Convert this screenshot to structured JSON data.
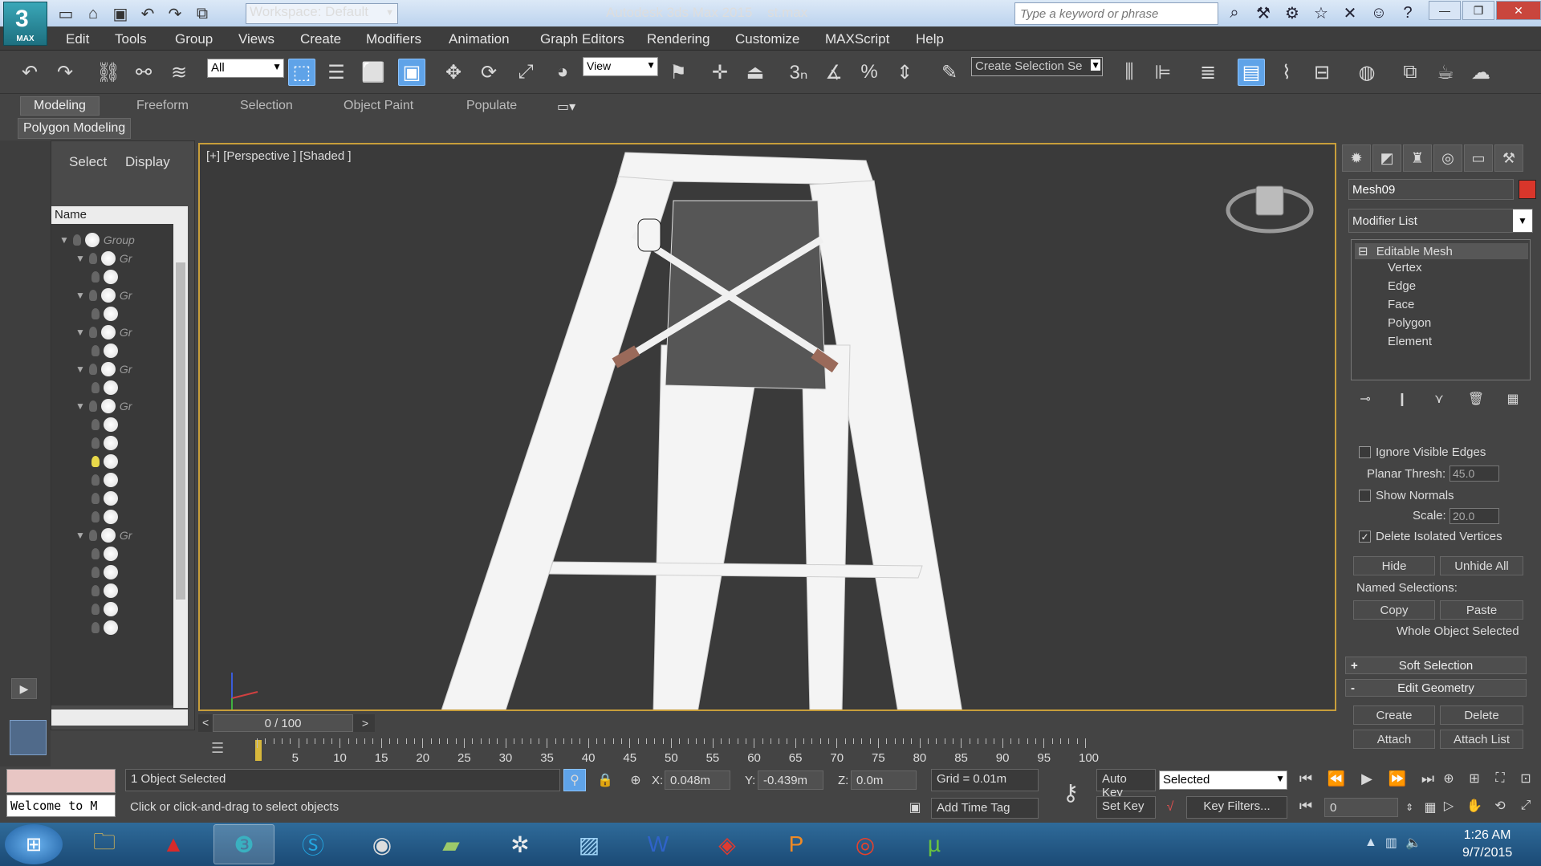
{
  "app": {
    "logo_label": "MAX",
    "title": "Autodesk 3ds Max  2015",
    "filename": "st.max",
    "workspace": "Workspace: Default",
    "search_placeholder": "Type a keyword or phrase"
  },
  "menu": [
    "Edit",
    "Tools",
    "Group",
    "Views",
    "Create",
    "Modifiers",
    "Animation",
    "Graph Editors",
    "Rendering",
    "Customize",
    "MAXScript",
    "Help"
  ],
  "toolbar": {
    "selection_filter": "All",
    "ref_coord": "View",
    "named_selection": "Create Selection Se"
  },
  "ribbon": {
    "tabs": [
      "Modeling",
      "Freeform",
      "Selection",
      "Object Paint",
      "Populate"
    ],
    "active_tab": "Modeling",
    "panel": "Polygon Modeling"
  },
  "scene_explorer": {
    "tabs": [
      "Select",
      "Display"
    ],
    "column": "Name",
    "top_group": "Group",
    "child_label": "Gr"
  },
  "viewport": {
    "label": "[+] [Perspective ] [Shaded ]"
  },
  "command_panel": {
    "object_name": "Mesh09",
    "object_color": "#d9362b",
    "modifier_list": "Modifier List",
    "stack_root": "Editable Mesh",
    "stack_items": [
      "Vertex",
      "Edge",
      "Face",
      "Polygon",
      "Element"
    ],
    "ignore_visible_edges": "Ignore Visible Edges",
    "planar_thresh_label": "Planar Thresh:",
    "planar_thresh": "45.0",
    "show_normals": "Show Normals",
    "scale_label": "Scale:",
    "scale": "20.0",
    "delete_isolated": "Delete Isolated Vertices",
    "hide": "Hide",
    "unhide_all": "Unhide All",
    "named_selections": "Named Selections:",
    "copy": "Copy",
    "paste": "Paste",
    "whole_object": "Whole Object Selected",
    "soft_selection": "Soft Selection",
    "edit_geometry": "Edit Geometry",
    "create": "Create",
    "delete": "Delete",
    "attach": "Attach",
    "attach_list": "Attach List"
  },
  "timeline": {
    "slider": "0 / 100",
    "ticks": [
      "5",
      "10",
      "15",
      "20",
      "25",
      "30",
      "35",
      "40",
      "45",
      "50",
      "55",
      "60",
      "65",
      "70",
      "75",
      "80",
      "85",
      "90",
      "95",
      "100"
    ]
  },
  "status": {
    "listener": "Welcome to M",
    "selection": "1 Object Selected",
    "prompt": "Click or click-and-drag to select objects",
    "x_label": "X:",
    "x": "0.048m",
    "y_label": "Y:",
    "y": "-0.439m",
    "z_label": "Z:",
    "z": "0.0m",
    "grid": "Grid = 0.01m",
    "add_time_tag": "Add Time Tag",
    "auto_key": "Auto Key",
    "set_key": "Set Key",
    "key_mode": "Selected",
    "key_filters": "Key Filters...",
    "frame": "0"
  },
  "clock": {
    "time": "1:26 AM",
    "date": "9/7/2015"
  }
}
